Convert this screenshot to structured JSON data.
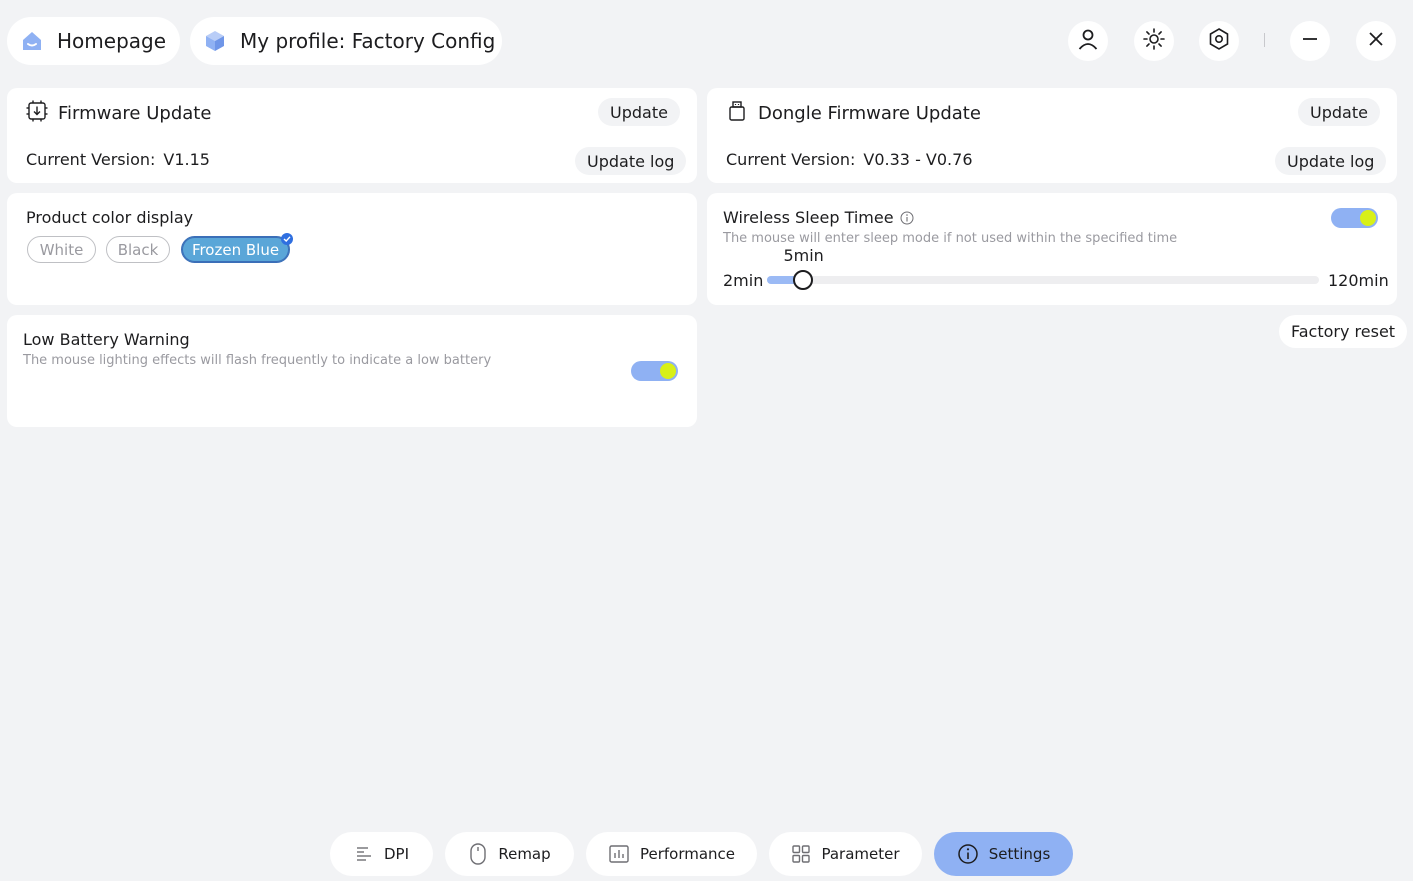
{
  "header": {
    "home_label": "Homepage",
    "profile_label": "My profile: Factory Config"
  },
  "firmware": {
    "title": "Firmware Update",
    "update_label": "Update",
    "version_label": "Current Version:",
    "version_value": "V1.15",
    "log_label": "Update log"
  },
  "dongle": {
    "title": "Dongle Firmware Update",
    "update_label": "Update",
    "version_label": "Current Version:",
    "version_value": "V0.33 - V0.76",
    "log_label": "Update log"
  },
  "color_display": {
    "title": "Product color display",
    "options": [
      "White",
      "Black",
      "Frozen Blue"
    ],
    "selected": "Frozen Blue"
  },
  "sleep": {
    "title": "Wireless Sleep Timee",
    "description": "The mouse will enter sleep mode if not used within the specified time",
    "enabled": true,
    "value_label": "5min",
    "min_label": "2min",
    "max_label": "120min",
    "value": 5,
    "min": 2,
    "max": 120
  },
  "battery": {
    "title": "Low Battery Warning",
    "description": "The mouse lighting effects will flash frequently to indicate a low battery",
    "enabled": true
  },
  "factory_reset_label": "Factory reset",
  "bottom_nav": {
    "items": [
      {
        "label": "DPI",
        "icon": "dpi-icon"
      },
      {
        "label": "Remap",
        "icon": "mouse-icon"
      },
      {
        "label": "Performance",
        "icon": "performance-icon"
      },
      {
        "label": "Parameter",
        "icon": "grid-icon"
      },
      {
        "label": "Settings",
        "icon": "info-icon"
      }
    ],
    "active": "Settings"
  },
  "colors": {
    "accent": "#8fb1f3",
    "toggle_knob": "#d8f018",
    "selected_chip": "#5aa6d8"
  }
}
